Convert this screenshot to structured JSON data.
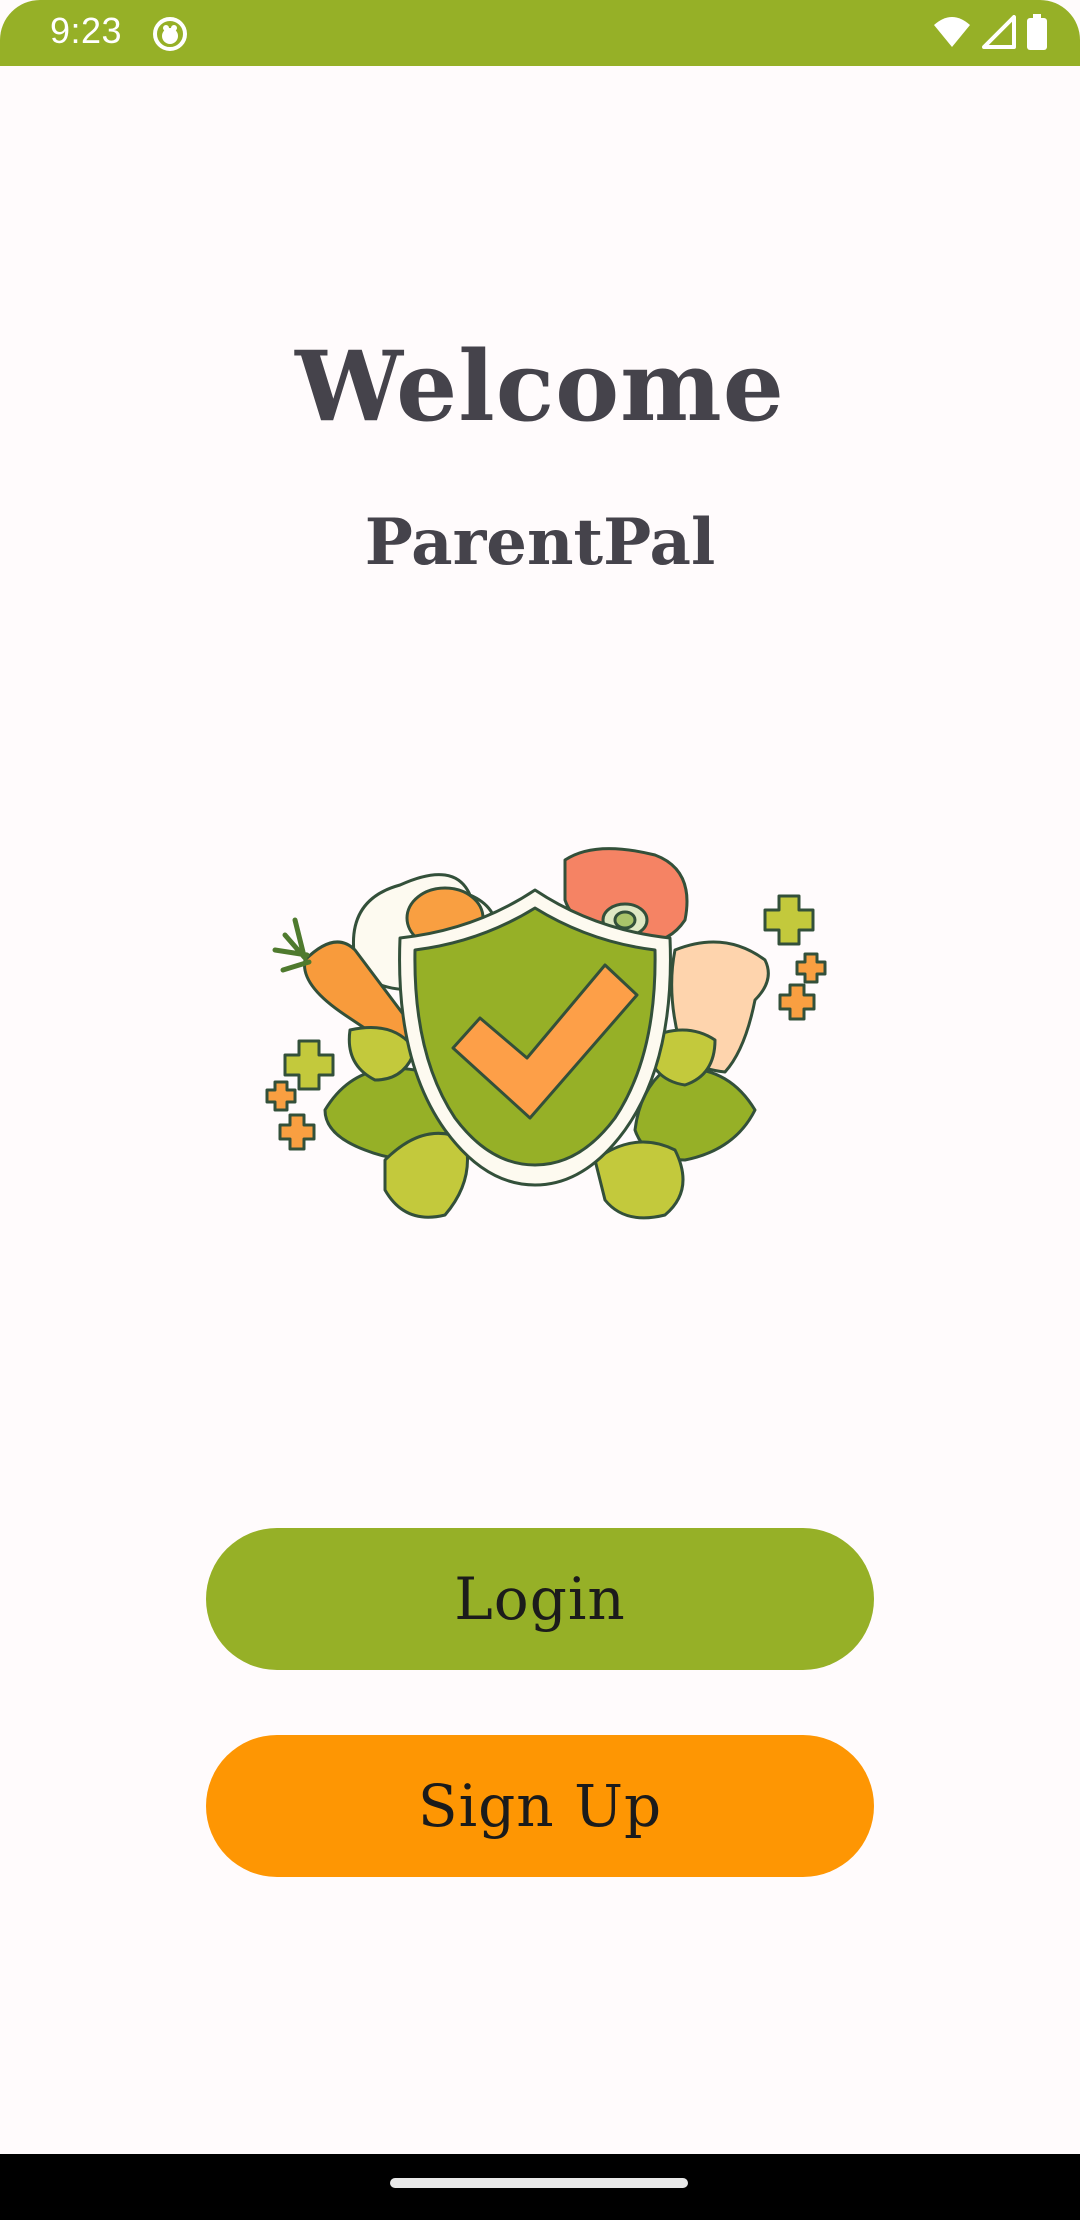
{
  "status_bar": {
    "time": "9:23",
    "background_color": "#96b027",
    "icons": [
      "app-notification-icon",
      "wifi-icon",
      "cell-signal-icon",
      "battery-icon"
    ]
  },
  "welcome": {
    "title": "Welcome",
    "app_name": "ParentPal"
  },
  "illustration": {
    "icon": "food-safety-shield-icon"
  },
  "buttons": {
    "login_label": "Login",
    "signup_label": "Sign Up",
    "login_color": "#96b027",
    "signup_color": "#fe9603"
  },
  "colors": {
    "background": "#fffbfc",
    "text": "#45434b"
  }
}
